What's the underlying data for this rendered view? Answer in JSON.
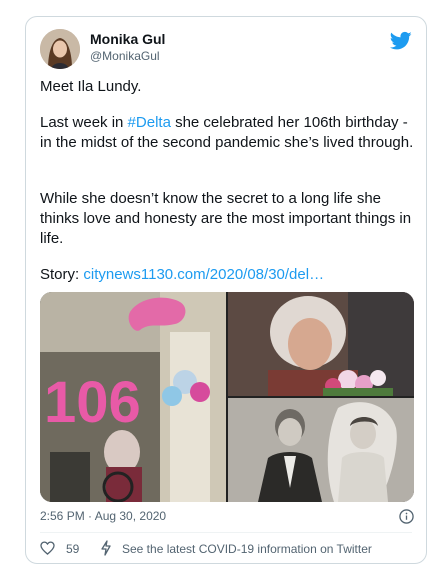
{
  "tweet": {
    "author_name": "Monika Gul",
    "author_handle": "@MonikaGul",
    "paragraph1": "Meet Ila Lundy.",
    "paragraph2_prefix": "Last week in ",
    "hashtag": "#Delta",
    "paragraph2_suffix": " she celebrated her 106th birthday - in the midst of the second pandemic she’s lived through.",
    "paragraph3": "While she doesn’t know the secret to a long life she thinks love and honesty are the most important things in life.",
    "story_label": "Story: ",
    "story_link": "citynews1130.com/2020/08/30/del…",
    "timestamp": "2:56 PM · Aug 30, 2020",
    "like_count": "59",
    "covid_info": "See the latest COVID-19 information on Twitter",
    "balloon_text": "106"
  },
  "icons": {
    "bird": "twitter-bird-icon",
    "info": "info-icon",
    "heart": "heart-icon",
    "bolt": "bolt-icon"
  },
  "colors": {
    "accent": "#1d9bf0",
    "text": "#0f1419",
    "muted": "#536471",
    "border": "#cfd9de"
  }
}
